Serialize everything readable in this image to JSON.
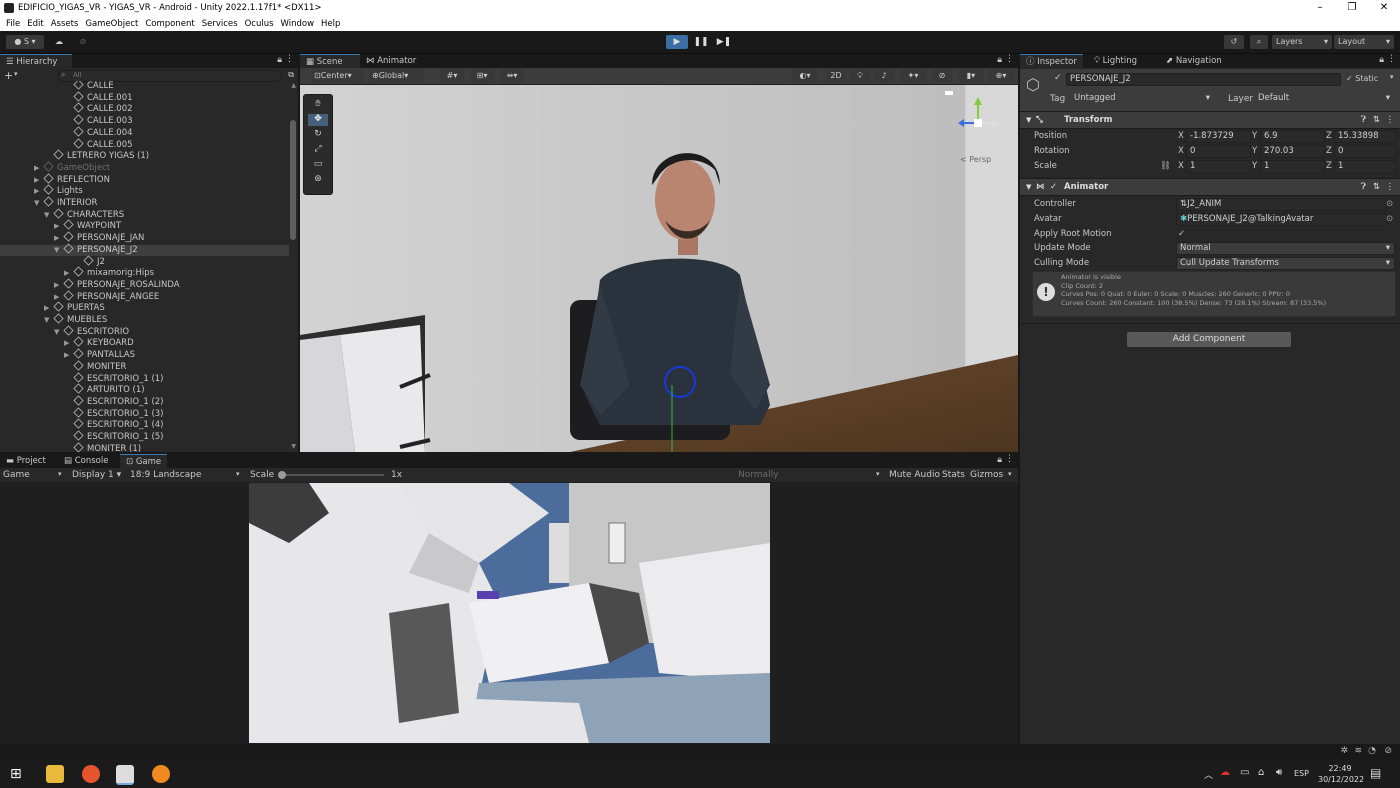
{
  "window": {
    "title": "EDIFICIO_YIGAS_VR - YIGAS_VR - Android - Unity 2022.1.17f1* <DX11>",
    "minimize": "–",
    "maximize": "❐",
    "close": "✕"
  },
  "menu": [
    "File",
    "Edit",
    "Assets",
    "GameObject",
    "Component",
    "Services",
    "Oculus",
    "Window",
    "Help"
  ],
  "toolbar": {
    "account": "S",
    "layers": "Layers",
    "layout": "Layout",
    "play": "▶",
    "pause": "❚❚",
    "step": "▶❚"
  },
  "hierarchy": {
    "tab": "Hierarchy",
    "add": "+",
    "search_placeholder": "All",
    "rows": [
      {
        "label": "CALLE",
        "indent": 74,
        "arrow": "",
        "dim": false,
        "sel": false
      },
      {
        "label": "CALLE.001",
        "indent": 74,
        "arrow": "",
        "dim": false,
        "sel": false
      },
      {
        "label": "CALLE.002",
        "indent": 74,
        "arrow": "",
        "dim": false,
        "sel": false
      },
      {
        "label": "CALLE.003",
        "indent": 74,
        "arrow": "",
        "dim": false,
        "sel": false
      },
      {
        "label": "CALLE.004",
        "indent": 74,
        "arrow": "",
        "dim": false,
        "sel": false
      },
      {
        "label": "CALLE.005",
        "indent": 74,
        "arrow": "",
        "dim": false,
        "sel": false
      },
      {
        "label": "LETRERO YIGAS (1)",
        "indent": 54,
        "arrow": "",
        "dim": false,
        "sel": false
      },
      {
        "label": "GameObject",
        "indent": 44,
        "arrow": "▶",
        "dim": true,
        "sel": false
      },
      {
        "label": "REFLECTION",
        "indent": 44,
        "arrow": "▶",
        "dim": false,
        "sel": false
      },
      {
        "label": "Lights",
        "indent": 44,
        "arrow": "▶",
        "dim": false,
        "sel": false
      },
      {
        "label": "INTERIOR",
        "indent": 44,
        "arrow": "▼",
        "dim": false,
        "sel": false
      },
      {
        "label": "CHARACTERS",
        "indent": 54,
        "arrow": "▼",
        "dim": false,
        "sel": false
      },
      {
        "label": "WAYPOINT",
        "indent": 64,
        "arrow": "▶",
        "dim": false,
        "sel": false
      },
      {
        "label": "PERSONAJE_JAN",
        "indent": 64,
        "arrow": "▶",
        "dim": false,
        "sel": false
      },
      {
        "label": "PERSONAJE_J2",
        "indent": 64,
        "arrow": "▼",
        "dim": false,
        "sel": true
      },
      {
        "label": "J2",
        "indent": 84,
        "arrow": "",
        "dim": false,
        "sel": false
      },
      {
        "label": "mixamorig:Hips",
        "indent": 74,
        "arrow": "▶",
        "dim": false,
        "sel": false
      },
      {
        "label": "PERSONAJE_ROSALINDA",
        "indent": 64,
        "arrow": "▶",
        "dim": false,
        "sel": false
      },
      {
        "label": "PERSONAJE_ANGEE",
        "indent": 64,
        "arrow": "▶",
        "dim": false,
        "sel": false
      },
      {
        "label": "PUERTAS",
        "indent": 54,
        "arrow": "▶",
        "dim": false,
        "sel": false
      },
      {
        "label": "MUEBLES",
        "indent": 54,
        "arrow": "▼",
        "dim": false,
        "sel": false
      },
      {
        "label": "ESCRITORIO",
        "indent": 64,
        "arrow": "▼",
        "dim": false,
        "sel": false
      },
      {
        "label": "KEYBOARD",
        "indent": 74,
        "arrow": "▶",
        "dim": false,
        "sel": false
      },
      {
        "label": "PANTALLAS",
        "indent": 74,
        "arrow": "▶",
        "dim": false,
        "sel": false
      },
      {
        "label": "MONITER",
        "indent": 74,
        "arrow": "",
        "dim": false,
        "sel": false
      },
      {
        "label": "ESCRITORIO_1 (1)",
        "indent": 74,
        "arrow": "",
        "dim": false,
        "sel": false
      },
      {
        "label": "ARTURITO (1)",
        "indent": 74,
        "arrow": "",
        "dim": false,
        "sel": false
      },
      {
        "label": "ESCRITORIO_1 (2)",
        "indent": 74,
        "arrow": "",
        "dim": false,
        "sel": false
      },
      {
        "label": "ESCRITORIO_1 (3)",
        "indent": 74,
        "arrow": "",
        "dim": false,
        "sel": false
      },
      {
        "label": "ESCRITORIO_1 (4)",
        "indent": 74,
        "arrow": "",
        "dim": false,
        "sel": false
      },
      {
        "label": "ESCRITORIO_1 (5)",
        "indent": 74,
        "arrow": "",
        "dim": false,
        "sel": false
      },
      {
        "label": "MONITER (1)",
        "indent": 74,
        "arrow": "",
        "dim": false,
        "sel": false
      }
    ]
  },
  "scene": {
    "tab_scene": "Scene",
    "tab_animator": "Animator",
    "pivot": "Center",
    "space": "Global",
    "mode2d": "2D",
    "persp": "< Persp"
  },
  "bottom": {
    "tab_project": "Project",
    "tab_console": "Console",
    "tab_game": "Game",
    "game": "Game",
    "display": "Display 1",
    "aspect": "18:9 Landscape",
    "scale_label": "Scale",
    "scale_value": "1x",
    "normally": "Normally",
    "mute": "Mute Audio",
    "stats": "Stats",
    "gizmos": "Gizmos"
  },
  "inspector": {
    "tab_inspector": "Inspector",
    "tab_lighting": "Lighting",
    "tab_navigation": "Navigation",
    "object_name": "PERSONAJE_J2",
    "static": "Static",
    "tag_label": "Tag",
    "tag": "Untagged",
    "layer_label": "Layer",
    "layer": "Default",
    "transform": {
      "title": "Transform",
      "position_label": "Position",
      "rotation_label": "Rotation",
      "scale_label": "Scale",
      "px": "-1.873729",
      "py": "6.9",
      "pz": "15.33898",
      "rx": "0",
      "ry": "270.03",
      "rz": "0",
      "sx": "1",
      "sy": "1",
      "sz": "1"
    },
    "animator": {
      "title": "Animator",
      "controller_label": "Controller",
      "controller": "J2_ANIM",
      "avatar_label": "Avatar",
      "avatar": "PERSONAJE_J2@TalkingAvatar",
      "root_motion_label": "Apply Root Motion",
      "update_label": "Update Mode",
      "update": "Normal",
      "culling_label": "Culling Mode",
      "culling": "Cull Update Transforms",
      "info_lines": [
        "Animator is visible",
        "Clip Count: 2",
        "Curves Pos: 0 Quat: 0 Euler: 0 Scale: 0 Muscles: 260 Generic: 0 PPtr: 0",
        "Curves Count: 260 Constant: 100 (38.5%) Dense: 73 (28.1%) Stream: 87 (33.5%)"
      ]
    },
    "add_component": "Add Component"
  },
  "taskbar": {
    "lang": "ESP",
    "time": "22:49",
    "date": "30/12/2022"
  }
}
